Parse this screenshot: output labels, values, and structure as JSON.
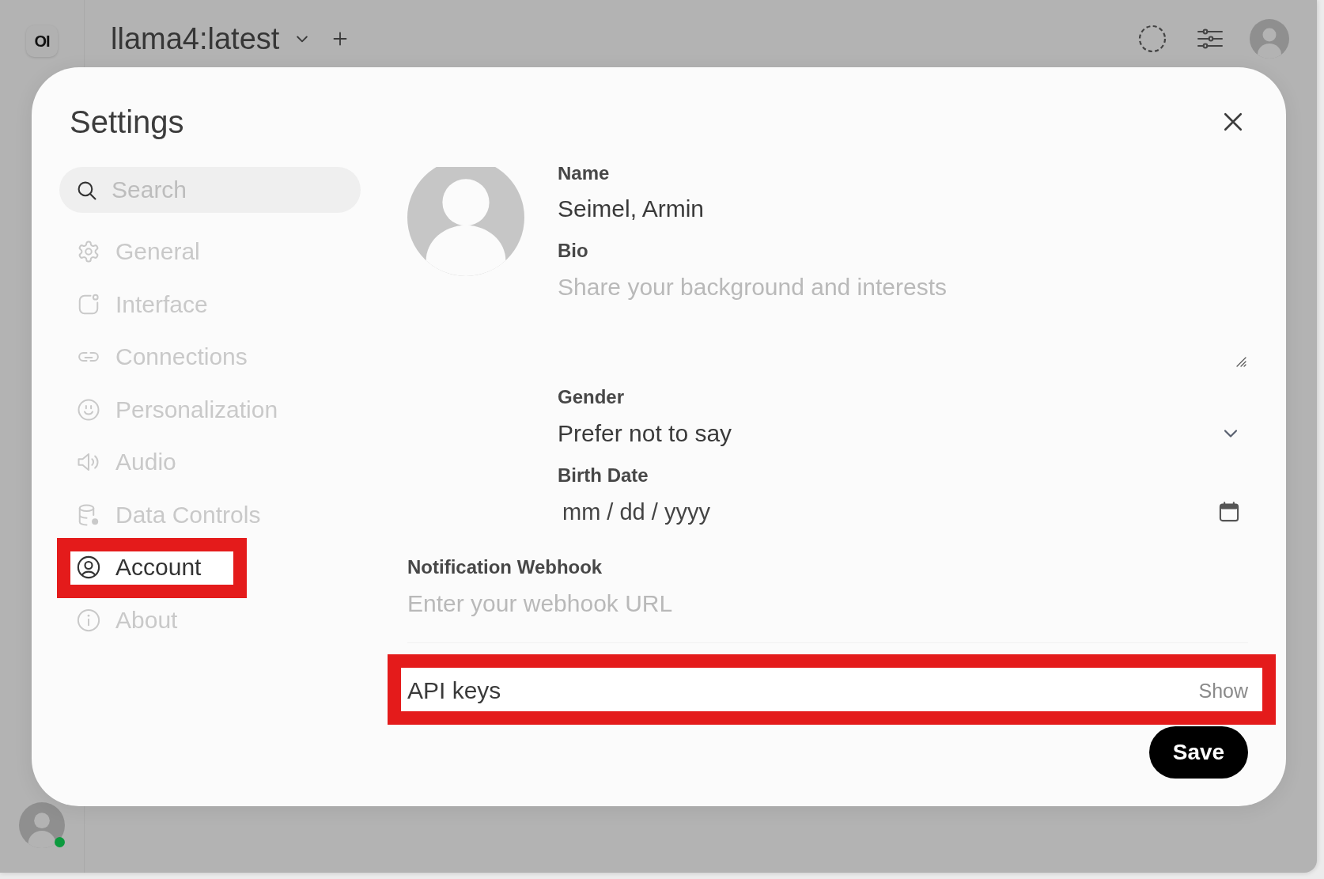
{
  "app": {
    "logo": "OI",
    "model_selector": {
      "label": "llama4:latest"
    },
    "sidebar_user": {
      "online": true
    }
  },
  "settings_dialog": {
    "title": "Settings",
    "search": {
      "placeholder": "Search"
    },
    "nav_items": [
      {
        "kind": "general",
        "label": "General",
        "selected": false,
        "highlighted": false
      },
      {
        "kind": "interface",
        "label": "Interface",
        "selected": false,
        "highlighted": false
      },
      {
        "kind": "connections",
        "label": "Connections",
        "selected": false,
        "highlighted": false
      },
      {
        "kind": "personalization",
        "label": "Personalization",
        "selected": false,
        "highlighted": false
      },
      {
        "kind": "audio",
        "label": "Audio",
        "selected": false,
        "highlighted": false
      },
      {
        "kind": "data",
        "label": "Data Controls",
        "selected": false,
        "highlighted": false
      },
      {
        "kind": "account",
        "label": "Account",
        "selected": true,
        "highlighted": true
      },
      {
        "kind": "about",
        "label": "About",
        "selected": false,
        "highlighted": false
      }
    ],
    "account": {
      "name": {
        "label": "Name",
        "value": "Seimel, Armin"
      },
      "bio": {
        "label": "Bio",
        "placeholder": "Share your background and interests"
      },
      "gender": {
        "label": "Gender",
        "value": "Prefer not to say"
      },
      "birth_date": {
        "label": "Birth Date",
        "placeholder": "mm / dd / yyyy"
      },
      "notification_webhook": {
        "label": "Notification Webhook",
        "placeholder": "Enter your webhook URL"
      },
      "api_keys": {
        "label": "API keys",
        "toggle": "Show",
        "highlighted": true
      },
      "save_button": "Save"
    }
  }
}
